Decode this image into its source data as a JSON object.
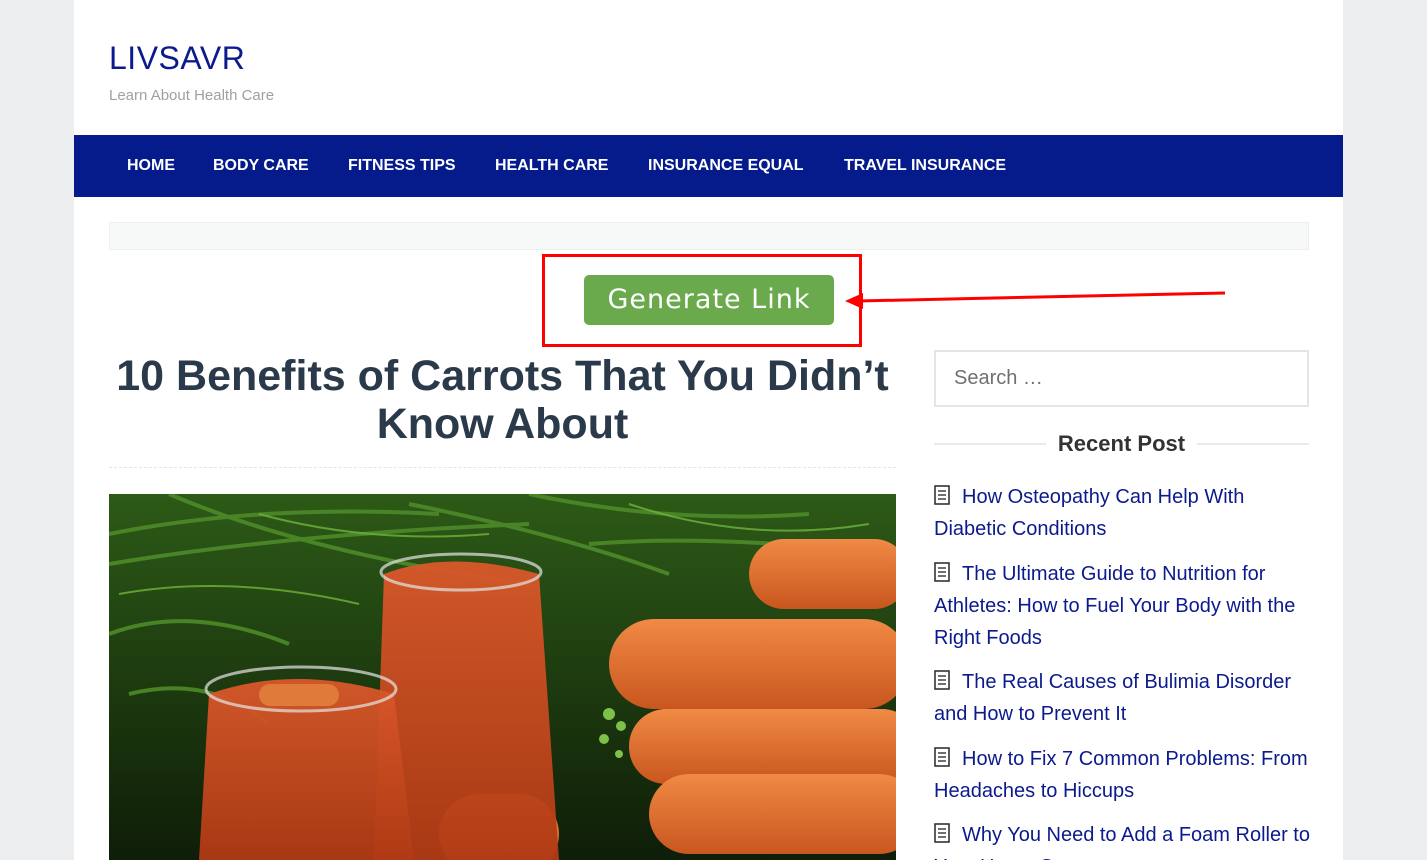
{
  "site": {
    "title": "LIVSAVR",
    "tagline": "Learn About Health Care"
  },
  "nav": {
    "items": [
      {
        "label": "HOME"
      },
      {
        "label": "BODY CARE"
      },
      {
        "label": "FITNESS TIPS"
      },
      {
        "label": "HEALTH CARE"
      },
      {
        "label": "INSURANCE EQUAL"
      },
      {
        "label": "TRAVEL INSURANCE"
      }
    ]
  },
  "generate": {
    "label": "Generate Link"
  },
  "post": {
    "title": "10 Benefits of Carrots That You Didn’t Know About"
  },
  "sidebar": {
    "search_placeholder": "Search …",
    "recent_title": "Recent Post",
    "recent": [
      {
        "label": "How Osteopathy Can Help With Diabetic Conditions"
      },
      {
        "label": "The Ultimate Guide to Nutrition for Athletes: How to Fuel Your Body with the Right Foods"
      },
      {
        "label": "The Real Causes of Bulimia Disorder and How to Prevent It"
      },
      {
        "label": "How to Fix 7 Common Problems: From Headaches to Hiccups"
      },
      {
        "label": "Why You Need to Add a Foam Roller to Your Home Gym"
      }
    ]
  },
  "colors": {
    "nav_bg": "#051b8c",
    "link": "#0b1a8c",
    "button": "#6aaa4c",
    "annotation": "#ff0000"
  }
}
